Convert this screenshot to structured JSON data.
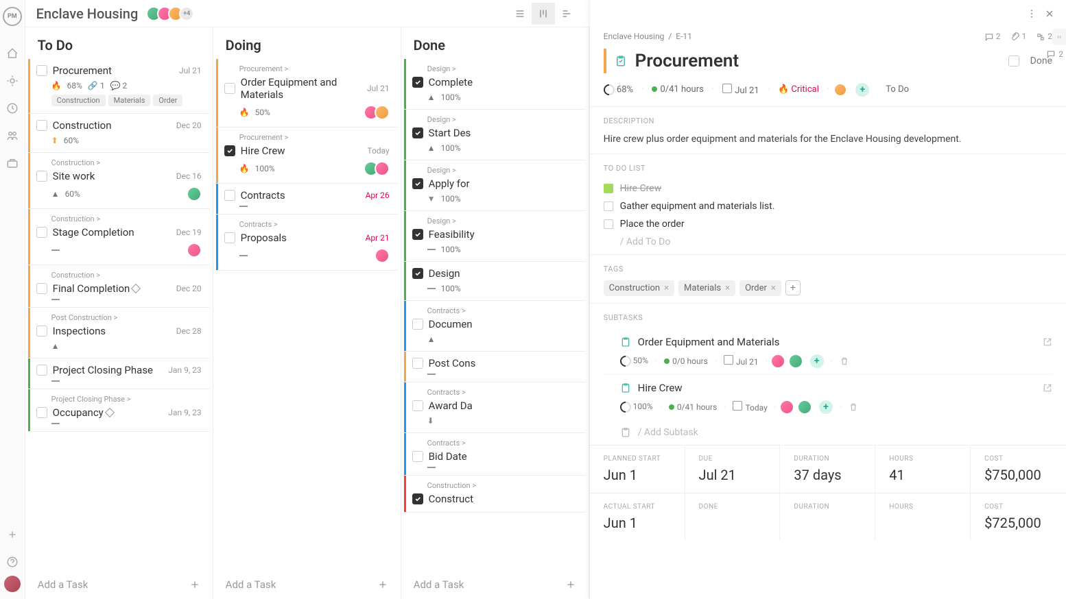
{
  "project": {
    "title": "Enclave Housing",
    "extra_avatars": "+4"
  },
  "columns": [
    {
      "title": "To Do",
      "cards": [
        {
          "accent": "orange",
          "title": "Procurement",
          "date": "Jul 21",
          "meta": {
            "fire": true,
            "pct": "68%",
            "attach": "1",
            "comments": "2"
          },
          "tags": [
            "Construction",
            "Materials",
            "Order"
          ]
        },
        {
          "accent": "orange",
          "title": "Construction",
          "date": "Dec 20",
          "meta": {
            "prio": "up",
            "pct": "60%"
          }
        },
        {
          "accent": "orange",
          "crumb": "Construction >",
          "title": "Site work",
          "date": "Dec 16",
          "meta": {
            "prio": "high",
            "pct": "60%"
          },
          "av": [
            "av1"
          ]
        },
        {
          "accent": "orange",
          "crumb": "Construction >",
          "title": "Stage Completion",
          "date": "Dec 19",
          "meta": {
            "minus": true
          },
          "av": [
            "av2"
          ]
        },
        {
          "accent": "orange",
          "crumb": "Construction >",
          "title": "Final Completion",
          "diamond": true,
          "date": "Dec 20",
          "meta": {
            "minus": true
          }
        },
        {
          "accent": "orange",
          "crumb": "Post Construction >",
          "title": "Inspections",
          "date": "Dec 28",
          "meta": {
            "prio": "high"
          }
        },
        {
          "accent": "green",
          "title": "Project Closing Phase",
          "date": "Jan 9, 23",
          "meta": {
            "minus": true
          }
        },
        {
          "accent": "green",
          "crumb": "Project Closing Phase >",
          "title": "Occupancy",
          "diamond": true,
          "date": "Jan 9, 23",
          "meta": {
            "minus": true
          }
        }
      ]
    },
    {
      "title": "Doing",
      "cards": [
        {
          "accent": "orange",
          "crumb": "Procurement >",
          "title": "Order Equipment and Materials",
          "date": "Jul 21",
          "meta": {
            "fire": true,
            "pct": "50%"
          },
          "av": [
            "av2",
            "av3"
          ]
        },
        {
          "accent": "orange",
          "crumb": "Procurement >",
          "title": "Hire Crew",
          "date": "Today",
          "checked": true,
          "meta": {
            "fire": true,
            "pct": "100%"
          },
          "av": [
            "av1",
            "av2"
          ]
        },
        {
          "accent": "blue",
          "title": "Contracts",
          "date": "Apr 26",
          "overdue": true,
          "meta": {
            "minus": true
          }
        },
        {
          "accent": "blue",
          "crumb": "Contracts >",
          "title": "Proposals",
          "date": "Apr 21",
          "overdue": true,
          "meta": {
            "minus": true
          },
          "av": [
            "av2"
          ]
        }
      ]
    },
    {
      "title": "Done",
      "cards": [
        {
          "accent": "green",
          "crumb": "Design >",
          "title": "Complete",
          "checked": true,
          "meta": {
            "prio": "high",
            "pct": "100%"
          }
        },
        {
          "accent": "green",
          "crumb": "Design >",
          "title": "Start Des",
          "checked": true,
          "meta": {
            "prio": "high",
            "pct": "100%"
          }
        },
        {
          "accent": "green",
          "crumb": "Design >",
          "title": "Apply for",
          "checked": true,
          "meta": {
            "prio": "down",
            "pct": "100%"
          }
        },
        {
          "accent": "green",
          "crumb": "Design >",
          "title": "Feasibility",
          "checked": true,
          "meta": {
            "minus": true,
            "pct": "100%"
          }
        },
        {
          "accent": "green",
          "title": "Design",
          "checked": true,
          "meta": {
            "minus": true,
            "pct": "100%"
          }
        },
        {
          "accent": "blue",
          "crumb": "Contracts >",
          "title": "Documen",
          "meta": {
            "prio": "high"
          }
        },
        {
          "accent": "orange",
          "title": "Post Cons",
          "meta": {
            "minus": true
          }
        },
        {
          "accent": "blue",
          "crumb": "Contracts >",
          "title": "Award Da",
          "meta": {
            "prio": "down-g"
          }
        },
        {
          "accent": "blue",
          "crumb": "Contracts >",
          "title": "Bid Date",
          "meta": {
            "minus": true
          }
        },
        {
          "accent": "red",
          "crumb": "Construction >",
          "title": "Construct",
          "checked": true
        }
      ]
    }
  ],
  "add_task": "Add a Task",
  "detail": {
    "crumbs": {
      "project": "Enclave Housing",
      "id": "E-11"
    },
    "head_meta": {
      "comments": "2",
      "attach": "1",
      "subtasks": "2"
    },
    "title": "Procurement",
    "done_label": "Done",
    "metrics": {
      "pct": "68%",
      "hours": "0/41 hours",
      "date": "Jul 21",
      "priority": "Critical",
      "status": "To Do"
    },
    "desc_label": "Description",
    "desc": "Hire crew plus order equipment and materials for the Enclave Housing development.",
    "todo_label": "To Do List",
    "todos": [
      {
        "text": "Hire Crew",
        "done": true
      },
      {
        "text": "Gather equipment and materials list.",
        "done": false
      },
      {
        "text": "Place the order",
        "done": false
      }
    ],
    "add_todo": "/ Add To Do",
    "tags_label": "Tags",
    "tags": [
      "Construction",
      "Materials",
      "Order"
    ],
    "subtasks_label": "Subtasks",
    "subtasks": [
      {
        "title": "Order Equipment and Materials",
        "pct": "50%",
        "hours": "0/0 hours",
        "date": "Jul 21"
      },
      {
        "title": "Hire Crew",
        "pct": "100%",
        "hours": "0/41 hours",
        "date": "Today"
      }
    ],
    "add_subtask": "/ Add Subtask",
    "stats1": [
      {
        "label": "Planned Start",
        "val": "Jun 1"
      },
      {
        "label": "Due",
        "val": "Jul 21"
      },
      {
        "label": "Duration",
        "val": "37 days"
      },
      {
        "label": "Hours",
        "val": "41"
      },
      {
        "label": "Cost",
        "val": "$750,000"
      }
    ],
    "stats2": [
      {
        "label": "Actual Start",
        "val": "Jun 1"
      },
      {
        "label": "Done",
        "val": ""
      },
      {
        "label": "Duration",
        "val": ""
      },
      {
        "label": "Hours",
        "val": ""
      },
      {
        "label": "Cost",
        "val": "$725,000"
      }
    ],
    "side_comments": "2"
  }
}
